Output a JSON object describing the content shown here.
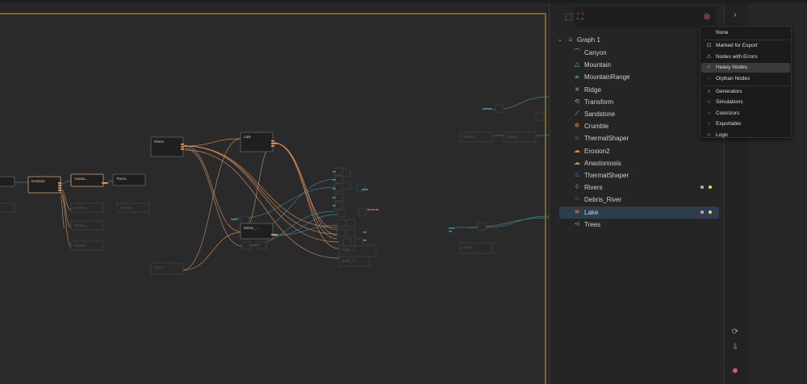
{
  "graph": {
    "nodes": {
      "erosion2": "Erosion2",
      "anasto": "Anasto...",
      "thermo": "Therm...",
      "rivers": "Rivers",
      "lake": "Lake",
      "debris": "Debris_...",
      "trees": "Trees",
      "terrain": "Terrain",
      "valleys": "Valleys",
      "mask1": "Mask_1...",
      "mask2": "Mask_2...",
      "mask3": "Mask...",
      "faded": [
        "Erosion...",
        "Erosion...",
        "Erosion...",
        "Sharpe..."
      ]
    }
  },
  "panel": {
    "toolbar": {
      "select_icon": "select-icon",
      "focus_icon": "focus-icon",
      "clear_icon": "clear-filter-icon"
    },
    "tree": {
      "root_label": "Graph 1",
      "items": [
        {
          "label": "Canyon",
          "icon": "canyon-icon",
          "color": "#5fbf8a"
        },
        {
          "label": "Mountain",
          "icon": "mountain-icon",
          "color": "#5fbf8a"
        },
        {
          "label": "MountainRange",
          "icon": "mountain-range-icon",
          "color": "#5fbf8a"
        },
        {
          "label": "Ridge",
          "icon": "ridge-icon",
          "color": "#5fbf8a"
        },
        {
          "label": "Transform",
          "icon": "transform-icon",
          "color": "#7aa7c7"
        },
        {
          "label": "Sandstone",
          "icon": "sandstone-icon",
          "color": "#b0c7a8"
        },
        {
          "label": "Crumble",
          "icon": "crumble-icon",
          "color": "#e08a4a"
        },
        {
          "label": "ThermalShaper",
          "icon": "thermal-icon",
          "color": "#6aa4c4"
        },
        {
          "label": "Erosion2",
          "icon": "erosion-icon",
          "color": "#e08a4a"
        },
        {
          "label": "Anastomosis",
          "icon": "anastomosis-icon",
          "color": "#e08a4a"
        },
        {
          "label": "ThermalShaper",
          "icon": "thermal-icon",
          "color": "#6aa4c4"
        },
        {
          "label": "Rivers",
          "icon": "rivers-icon",
          "color": "#e08a4a",
          "dots": [
            "#d49bd1",
            "#e9d46a"
          ]
        },
        {
          "label": "Debris_River",
          "icon": "debris-icon",
          "color": "#e08a4a"
        },
        {
          "label": "Lake",
          "icon": "lake-icon",
          "color": "#e08a4a",
          "dots": [
            "#d49bd1",
            "#e9d46a"
          ],
          "selected": true
        },
        {
          "label": "Trees",
          "icon": "trees-icon",
          "color": "#e08a4a"
        }
      ]
    }
  },
  "filter_menu": {
    "items": [
      {
        "label": "None",
        "icon": ""
      },
      {
        "label": "Marked for Export",
        "icon": "export-mark-icon"
      },
      {
        "label": "Nodes with Errors",
        "icon": "warning-icon"
      },
      {
        "label": "Heavy Nodes",
        "icon": "check-icon",
        "checked": true
      },
      {
        "label": "Orphan Nodes",
        "icon": "orphan-icon"
      },
      {
        "label": "Generators",
        "icon": "dot-icon",
        "color": "#e9d46a"
      },
      {
        "label": "Simulations",
        "icon": "dot-icon",
        "color": "#e0a24a"
      },
      {
        "label": "Colorizors",
        "icon": "dot-icon",
        "color": "#9b7ad0"
      },
      {
        "label": "Exportable",
        "icon": "dot-icon",
        "color": "#e06060"
      },
      {
        "label": "Logic",
        "icon": "dot-icon",
        "color": "#cfcfcf"
      }
    ]
  },
  "side_bar": {
    "collapse": "›",
    "icons": [
      "refresh-icon",
      "download-icon",
      "bug-icon"
    ]
  }
}
